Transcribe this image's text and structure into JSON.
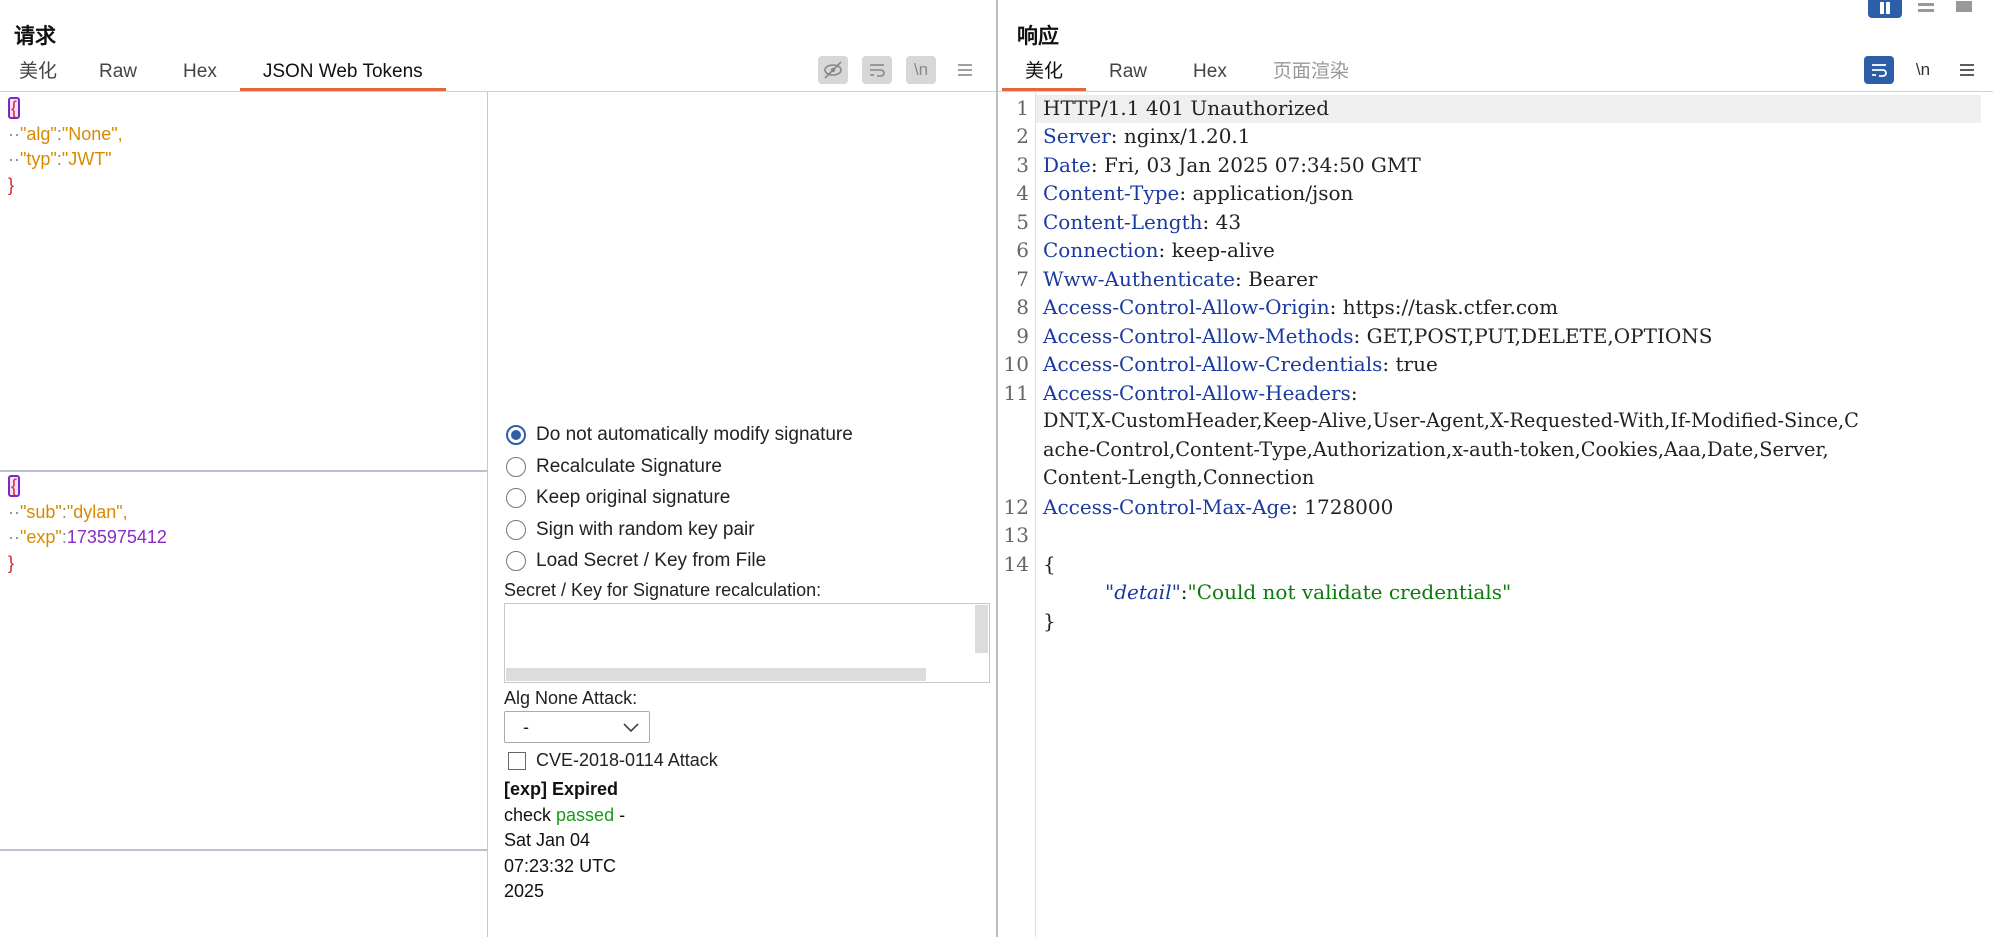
{
  "request": {
    "title": "请求",
    "tabs": [
      "美化",
      "Raw",
      "Hex",
      "JSON Web Tokens"
    ]
  },
  "response": {
    "title": "响应",
    "tabs": [
      "美化",
      "Raw",
      "Hex",
      "页面渲染"
    ]
  },
  "jwt": {
    "header": {
      "alg_key": "\"alg\"",
      "alg_val": "\"None\",",
      "typ_key": "\"typ\"",
      "typ_val": "\"JWT\""
    },
    "payload": {
      "sub_key": "\"sub\"",
      "sub_val": "\"dylan\",",
      "exp_key": "\"exp\"",
      "exp_val": "1735975412"
    }
  },
  "signature_options": {
    "items": [
      "Do not automatically modify signature",
      "Recalculate Signature",
      "Keep original signature",
      "Sign with random key pair",
      "Load Secret / Key from File"
    ],
    "selected_index": 0,
    "secret_label": "Secret / Key for Signature recalculation:",
    "alg_none_label": "Alg None Attack:",
    "alg_none_value": "-",
    "cve_label": "CVE-2018-0114 Attack",
    "cve_checked": false,
    "exp_title": "[exp] Expired",
    "check_prefix": "check ",
    "check_passed": "passed",
    "check_suffix": " -",
    "date_line1": "Sat Jan 04",
    "date_line2": "07:23:32 UTC",
    "date_line3": "2025"
  },
  "response_lines": [
    {
      "n": "1",
      "name": "HTTP/1.1 401 Unauthorized",
      "value": ""
    },
    {
      "n": "2",
      "name": "Server",
      "value": "nginx/1.20.1"
    },
    {
      "n": "3",
      "name": "Date",
      "value": "Fri, 03 Jan 2025 07:34:50 GMT"
    },
    {
      "n": "4",
      "name": "Content-Type",
      "value": "application/json"
    },
    {
      "n": "5",
      "name": "Content-Length",
      "value": "43"
    },
    {
      "n": "6",
      "name": "Connection",
      "value": "keep-alive"
    },
    {
      "n": "7",
      "name": "Www-Authenticate",
      "value": "Bearer"
    },
    {
      "n": "8",
      "name": "Access-Control-Allow-Origin",
      "value": "https://task.ctfer.com"
    },
    {
      "n": "9",
      "name": "Access-Control-Allow-Methods",
      "value": "GET,POST,PUT,DELETE,OPTIONS"
    },
    {
      "n": "10",
      "name": "Access-Control-Allow-Credentials",
      "value": "true"
    },
    {
      "n": "11",
      "name": "Access-Control-Allow-Headers",
      "value": ""
    },
    {
      "n": "12",
      "name": "Access-Control-Max-Age",
      "value": "1728000"
    },
    {
      "n": "13",
      "name": "",
      "value": ""
    },
    {
      "n": "14",
      "name": "",
      "value": ""
    }
  ],
  "allow_headers_wrapped": [
    "DNT,X-CustomHeader,Keep-Alive,User-Agent,X-Requested-With,If-Modified-Since,C",
    "ache-Control,Content-Type,Authorization,x-auth-token,Cookies,Aaa,Date,Server,",
    "Content-Length,Connection"
  ],
  "body_json": {
    "open": "{",
    "key": "\"detail\"",
    "colon": ":",
    "value": "\"Could not validate credentials\"",
    "close": "}"
  },
  "colors": {
    "accent": "#e8643c",
    "header_name": "#1a3aa0",
    "json_key": "#d88a00",
    "json_number": "#8a2cc8",
    "json_string_resp": "#0a7a0a",
    "radio_selected": "#2c5fa8"
  }
}
